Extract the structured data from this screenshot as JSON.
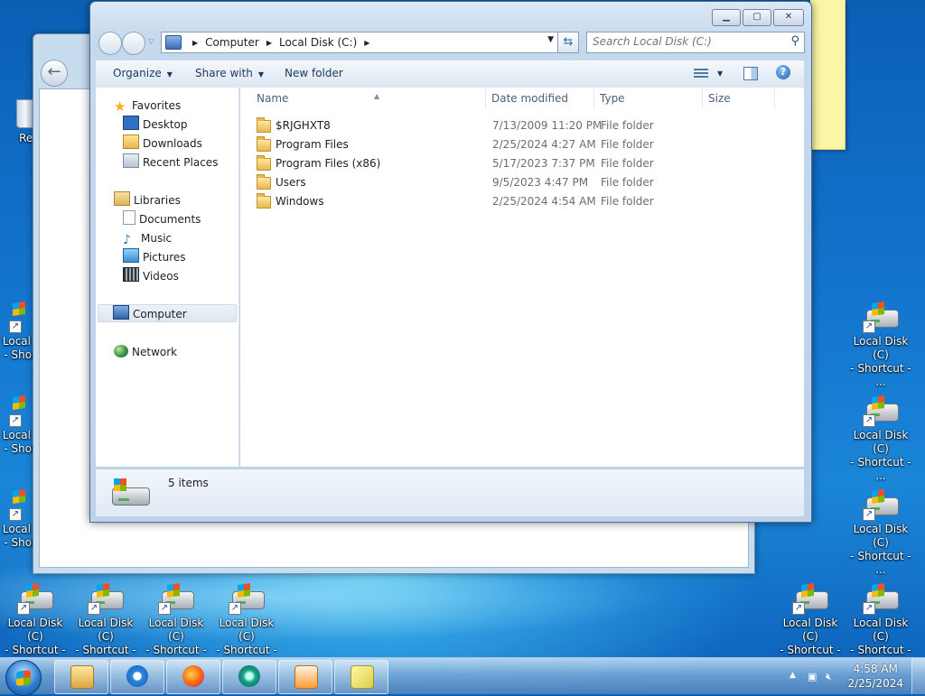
{
  "desktop": {
    "recycle_label": "Recy",
    "shortcut_line1": "Local Disk (C)",
    "shortcut_line2": "- Shortcut - ...",
    "left_partial_line1": "Local",
    "left_partial_line2": "- Shor"
  },
  "window": {
    "address": {
      "crumbs": [
        "Computer",
        "Local Disk (C:)"
      ]
    },
    "search_placeholder": "Search Local Disk (C:)",
    "toolbar": {
      "organize": "Organize",
      "share_with": "Share with",
      "new_folder": "New folder"
    },
    "nav": {
      "favorites": "Favorites",
      "desktop": "Desktop",
      "downloads": "Downloads",
      "recent": "Recent Places",
      "libraries": "Libraries",
      "documents": "Documents",
      "music": "Music",
      "pictures": "Pictures",
      "videos": "Videos",
      "computer": "Computer",
      "network": "Network"
    },
    "columns": {
      "name": "Name",
      "date": "Date modified",
      "type": "Type",
      "size": "Size"
    },
    "files": [
      {
        "name": "$RJGHXT8",
        "date": "7/13/2009 11:20 PM",
        "type": "File folder"
      },
      {
        "name": "Program Files",
        "date": "2/25/2024 4:27 AM",
        "type": "File folder"
      },
      {
        "name": "Program Files (x86)",
        "date": "5/17/2023 7:37 PM",
        "type": "File folder"
      },
      {
        "name": "Users",
        "date": "9/5/2023 4:47 PM",
        "type": "File folder"
      },
      {
        "name": "Windows",
        "date": "2/25/2024 4:54 AM",
        "type": "File folder"
      }
    ],
    "status": "5 items"
  },
  "taskbar": {
    "time": "4:58 AM",
    "date": "2/25/2024"
  },
  "colors": {
    "accent": "#1e395b",
    "desktop_blue": "#1476cf"
  }
}
